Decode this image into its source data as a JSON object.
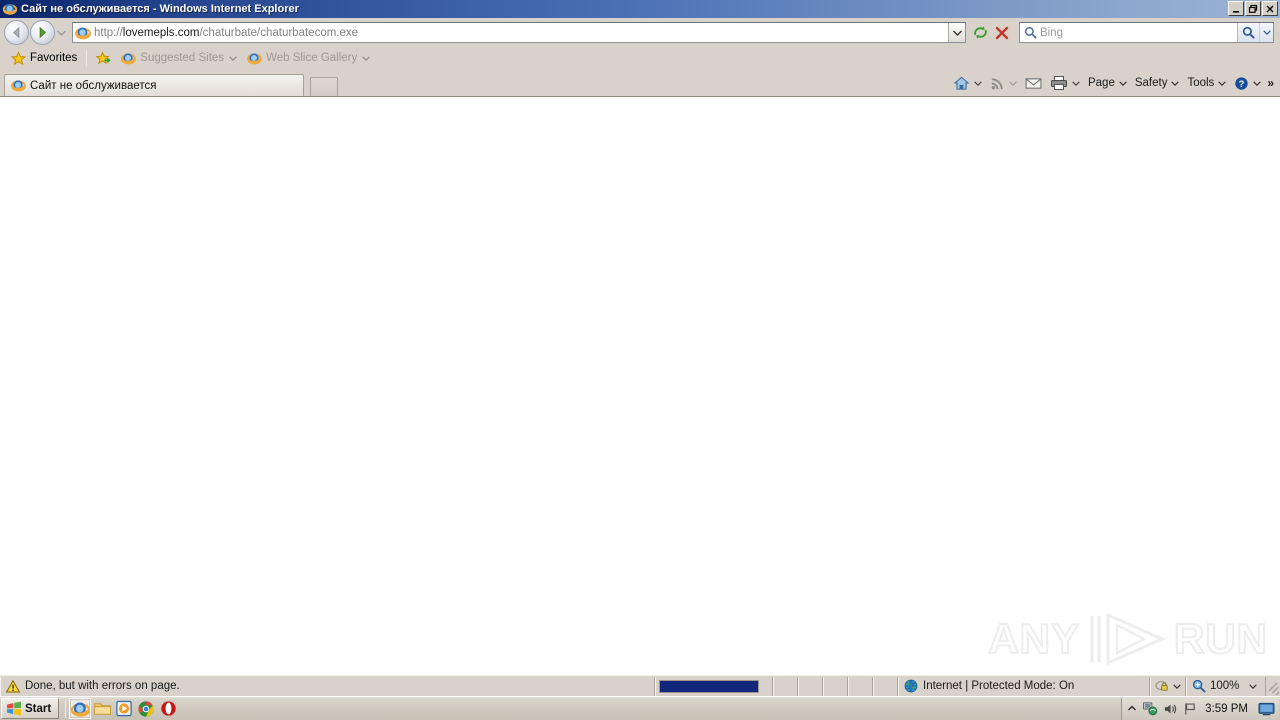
{
  "window": {
    "title": "Сайт не обслуживается - Windows Internet Explorer",
    "icon": "ie-icon",
    "minimize_label": "Minimize",
    "restore_label": "Restore",
    "close_label": "Close"
  },
  "navigation": {
    "back_label": "Back",
    "forward_label": "Forward",
    "recent_pages_label": "Recent Pages",
    "address": {
      "icon": "ie-page-icon",
      "scheme": "http://",
      "host": "lovemepls.com",
      "path": "/chaturbate/chaturbatecom.exe",
      "full_url": "http://lovemepls.com/chaturbate/chaturbatecom.exe",
      "dropdown_label": "Address dropdown"
    },
    "refresh_label": "Refresh",
    "stop_label": "Stop",
    "search": {
      "placeholder": "Bing",
      "value": "",
      "go_label": "Search",
      "provider_dropdown_label": "Search provider"
    }
  },
  "favorites_bar": {
    "favorites_label": "Favorites",
    "add_to_favorites_label": "Add to Favorites Bar",
    "items": [
      {
        "label": "Suggested Sites",
        "icon": "ie-icon",
        "has_caret": true,
        "dim": true
      },
      {
        "label": "Web Slice Gallery",
        "icon": "ie-icon",
        "has_caret": true,
        "dim": true
      }
    ]
  },
  "tabs": {
    "items": [
      {
        "label": "Сайт не обслуживается",
        "icon": "ie-icon",
        "active": true
      }
    ],
    "new_tab_label": "New Tab"
  },
  "command_bar": {
    "items": [
      {
        "name": "home",
        "icon": "home-icon",
        "label": "",
        "has_caret": true
      },
      {
        "name": "feeds",
        "icon": "rss-icon",
        "label": "",
        "has_caret": true
      },
      {
        "name": "mail",
        "icon": "mail-icon",
        "label": "",
        "has_caret": false
      },
      {
        "name": "print",
        "icon": "printer-icon",
        "label": "",
        "has_caret": true
      },
      {
        "name": "page",
        "icon": "",
        "label": "Page",
        "has_caret": true
      },
      {
        "name": "safety",
        "icon": "",
        "label": "Safety",
        "has_caret": true
      },
      {
        "name": "tools",
        "icon": "",
        "label": "Tools",
        "has_caret": true
      },
      {
        "name": "help",
        "icon": "help-icon",
        "label": "",
        "has_caret": true
      }
    ],
    "overflow_label": "»"
  },
  "page": {
    "body_text": "",
    "watermark": {
      "left": "ANY",
      "right": "RUN",
      "logo": "play-triangle-logo"
    }
  },
  "status_bar": {
    "message": "Done, but with errors on page.",
    "message_icon": "warning-icon",
    "progress_percent": 100,
    "zone": "Internet | Protected Mode: On",
    "zone_icon": "internet-globe-icon",
    "privacy_icon": "privacy-lock-icon",
    "privacy_caret_label": "Privacy report",
    "zoom_icon": "zoom-magnifier-icon",
    "zoom_level": "100%",
    "zoom_caret_label": "Change zoom level"
  },
  "taskbar": {
    "start_label": "Start",
    "start_icon": "windows-flag-icon",
    "quick_launch": [
      {
        "name": "internet-explorer",
        "icon": "ie-icon",
        "active": true
      },
      {
        "name": "windows-explorer",
        "icon": "folder-icon",
        "active": false
      },
      {
        "name": "windows-media-player",
        "icon": "media-player-icon",
        "active": false
      },
      {
        "name": "google-chrome",
        "icon": "chrome-icon",
        "active": false
      },
      {
        "name": "opera",
        "icon": "opera-icon",
        "active": false
      }
    ],
    "tray": {
      "expand_label": "Show hidden icons",
      "icons": [
        "network-icon",
        "volume-icon",
        "action-center-flag-icon"
      ],
      "clock": "3:59 PM",
      "show_desktop_label": "Show desktop"
    }
  },
  "colors": {
    "titlebar_start": "#0a246a",
    "titlebar_end": "#9fb4d6",
    "toolbar_bg": "#d8d2ca",
    "page_bg": "#ffffff",
    "progress_fill": "#13277a",
    "watermark": "#ececed"
  }
}
